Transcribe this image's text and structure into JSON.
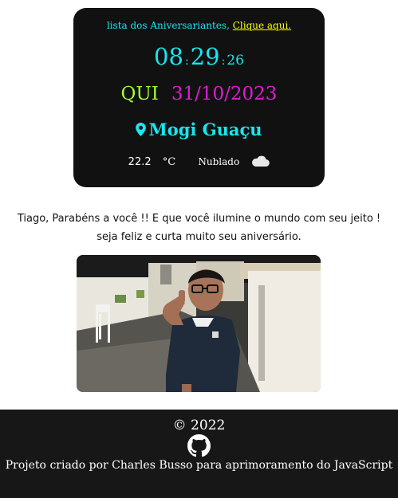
{
  "birthday_list": {
    "text": "lista dos Aniversariantes,",
    "link": "Clique aqui."
  },
  "clock": {
    "hours": "08",
    "minutes": "29",
    "seconds": "26",
    "separator": ":"
  },
  "date": {
    "weekday": "QUI",
    "full": "31/10/2023"
  },
  "location": {
    "city": "Mogi Guaçu",
    "icon": "map-pin-icon"
  },
  "weather": {
    "temperature": "22.2",
    "unit": "°C",
    "condition": "Nublado",
    "icon": "cloud-icon"
  },
  "message": {
    "line1": "Tiago, Parabéns a você !! E que você ilumine o mundo com seu jeito !",
    "line2": "seja feliz e curta muito seu aniversário."
  },
  "footer": {
    "copyright": "© 2022",
    "github_icon": "github-icon",
    "credit": "Projeto criado por Charles Busso para aprimoramento do JavaScript"
  },
  "colors": {
    "card_bg": "#111111",
    "cyan": "#19e6ef",
    "lime": "#a5ff2a",
    "magenta": "#e01bd5",
    "link_yellow": "#ffff00",
    "footer_bg": "#171717"
  }
}
